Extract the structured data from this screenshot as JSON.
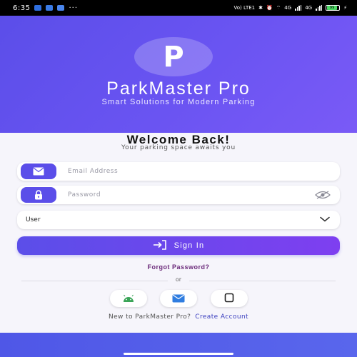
{
  "status_bar": {
    "time": "6:35",
    "dots": "···",
    "network_left": "Vo) LTE1",
    "network_mid": "4G",
    "network_right": "4G",
    "battery": "99"
  },
  "hero": {
    "logo_letter": "P",
    "title": "ParkMaster Pro",
    "subtitle": "Smart Solutions for Modern Parking"
  },
  "login": {
    "welcome": "Welcome Back!",
    "tagline": "Your parking space awaits you",
    "email_placeholder": "Email Address",
    "password_placeholder": "Password",
    "role_selected": "User",
    "sign_in_label": "Sign In",
    "forgot_password": "Forgot Password?",
    "or": "or",
    "new_user_text": "New to ParkMaster Pro?",
    "create_account": "Create Account"
  },
  "icons": {
    "email": "mail-icon",
    "password": "lock-icon",
    "visibility": "eye-off-icon",
    "dropdown": "chevron-down-icon",
    "sign_in": "login-icon",
    "social": [
      "android-icon",
      "mail-icon",
      "square-icon"
    ]
  },
  "colors": {
    "accent": "#5b4ee9",
    "accent_end": "#7e3ff0",
    "link": "#3b3fbf",
    "forgot": "#6b2a7a"
  }
}
